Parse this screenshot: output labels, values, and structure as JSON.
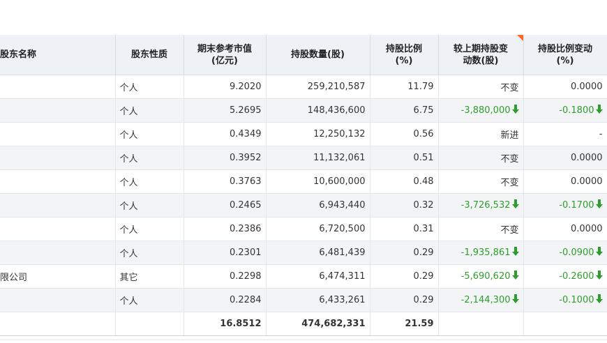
{
  "headers": {
    "name": "股东名称",
    "type": "股东性质",
    "market_value": "期末参考市值\n(亿元)",
    "shares": "持股数量(股)",
    "ratio": "持股比例\n(%)",
    "change": "较上期持股变\n动数(股)",
    "ratio_change": "持股比例变动\n(%)"
  },
  "colors": {
    "decrease": "#2e9d2e",
    "header_bg": "#eef1f6",
    "corner_flag": "#ff6a2a"
  },
  "rows": [
    {
      "name": "",
      "type": "个人",
      "market_value": "9.2020",
      "shares": "259,210,587",
      "ratio": "11.79",
      "change": "不变",
      "change_dir": "none",
      "ratio_change": "0.0000",
      "ratio_dir": "none"
    },
    {
      "name": "",
      "type": "个人",
      "market_value": "5.2695",
      "shares": "148,436,600",
      "ratio": "6.75",
      "change": "-3,880,000",
      "change_dir": "down",
      "ratio_change": "-0.1800",
      "ratio_dir": "down"
    },
    {
      "name": "",
      "type": "个人",
      "market_value": "0.4349",
      "shares": "12,250,132",
      "ratio": "0.56",
      "change": "新进",
      "change_dir": "none",
      "ratio_change": "-",
      "ratio_dir": "none"
    },
    {
      "name": "",
      "type": "个人",
      "market_value": "0.3952",
      "shares": "11,132,061",
      "ratio": "0.51",
      "change": "不变",
      "change_dir": "none",
      "ratio_change": "0.0000",
      "ratio_dir": "none"
    },
    {
      "name": "",
      "type": "个人",
      "market_value": "0.3763",
      "shares": "10,600,000",
      "ratio": "0.48",
      "change": "不变",
      "change_dir": "none",
      "ratio_change": "0.0000",
      "ratio_dir": "none"
    },
    {
      "name": "",
      "type": "个人",
      "market_value": "0.2465",
      "shares": "6,943,440",
      "ratio": "0.32",
      "change": "-3,726,532",
      "change_dir": "down",
      "ratio_change": "-0.1700",
      "ratio_dir": "down"
    },
    {
      "name": "",
      "type": "个人",
      "market_value": "0.2386",
      "shares": "6,720,500",
      "ratio": "0.31",
      "change": "不变",
      "change_dir": "none",
      "ratio_change": "0.0000",
      "ratio_dir": "none"
    },
    {
      "name": "",
      "type": "个人",
      "market_value": "0.2301",
      "shares": "6,481,439",
      "ratio": "0.29",
      "change": "-1,935,861",
      "change_dir": "down",
      "ratio_change": "-0.0900",
      "ratio_dir": "down"
    },
    {
      "name": "限公司",
      "type": "其它",
      "market_value": "0.2298",
      "shares": "6,474,311",
      "ratio": "0.29",
      "change": "-5,690,620",
      "change_dir": "down",
      "ratio_change": "-0.2600",
      "ratio_dir": "down"
    },
    {
      "name": "",
      "type": "个人",
      "market_value": "0.2284",
      "shares": "6,433,261",
      "ratio": "0.29",
      "change": "-2,144,300",
      "change_dir": "down",
      "ratio_change": "-0.1000",
      "ratio_dir": "down"
    }
  ],
  "total": {
    "market_value": "16.8512",
    "shares": "474,682,331",
    "ratio": "21.59"
  }
}
